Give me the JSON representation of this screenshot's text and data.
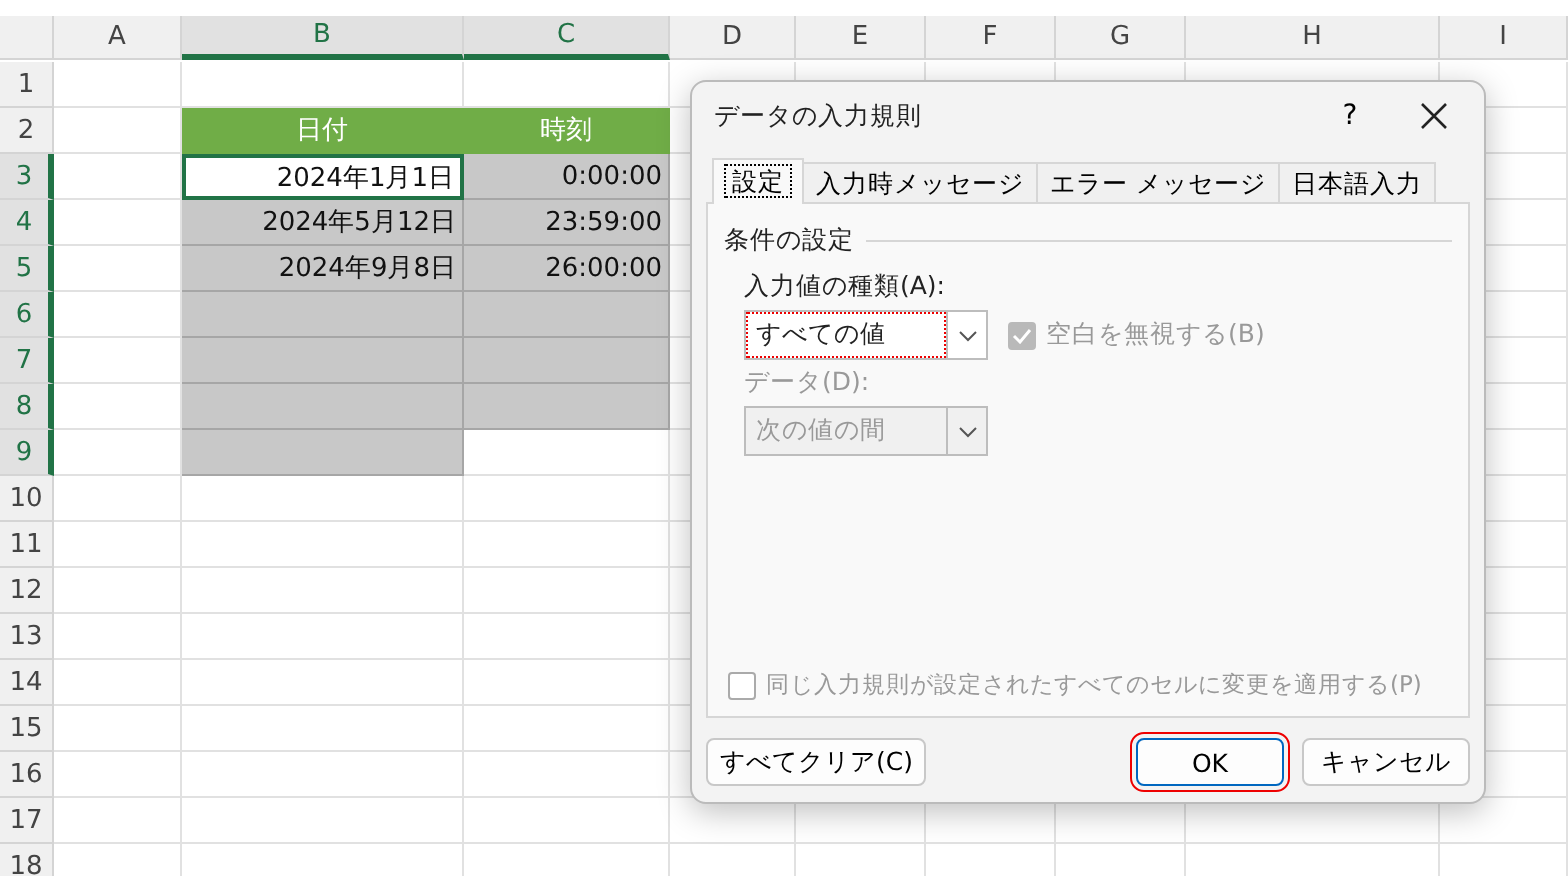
{
  "columns": [
    {
      "label": "A",
      "selected": false
    },
    {
      "label": "B",
      "selected": true
    },
    {
      "label": "C",
      "selected": true
    },
    {
      "label": "D",
      "selected": false
    },
    {
      "label": "E",
      "selected": false
    },
    {
      "label": "F",
      "selected": false
    },
    {
      "label": "G",
      "selected": false
    },
    {
      "label": "H",
      "selected": false
    },
    {
      "label": "I",
      "selected": false
    }
  ],
  "rows": [
    {
      "label": "1",
      "selected": false
    },
    {
      "label": "2",
      "selected": false,
      "b": {
        "text": "日付",
        "kind": "header"
      },
      "c": {
        "text": "時刻",
        "kind": "header"
      }
    },
    {
      "label": "3",
      "selected": true,
      "b": {
        "text": "2024年1月1日",
        "kind": "active"
      },
      "c": {
        "text": "0:00:00",
        "kind": "shaded"
      }
    },
    {
      "label": "4",
      "selected": true,
      "b": {
        "text": "2024年5月12日",
        "kind": "shaded"
      },
      "c": {
        "text": "23:59:00",
        "kind": "shaded"
      }
    },
    {
      "label": "5",
      "selected": true,
      "b": {
        "text": "2024年9月8日",
        "kind": "shaded"
      },
      "c": {
        "text": "26:00:00",
        "kind": "shaded"
      }
    },
    {
      "label": "6",
      "selected": true,
      "b": {
        "kind": "shaded"
      },
      "c": {
        "kind": "shaded"
      }
    },
    {
      "label": "7",
      "selected": true,
      "b": {
        "kind": "shaded"
      },
      "c": {
        "kind": "shaded"
      }
    },
    {
      "label": "8",
      "selected": true,
      "b": {
        "kind": "shaded"
      },
      "c": {
        "kind": "shaded"
      }
    },
    {
      "label": "9",
      "selected": true,
      "b": {
        "kind": "shaded"
      }
    },
    {
      "label": "10",
      "selected": false
    },
    {
      "label": "11",
      "selected": false
    },
    {
      "label": "12",
      "selected": false
    },
    {
      "label": "13",
      "selected": false
    },
    {
      "label": "14",
      "selected": false
    },
    {
      "label": "15",
      "selected": false
    },
    {
      "label": "16",
      "selected": false
    },
    {
      "label": "17",
      "selected": false
    },
    {
      "label": "18",
      "selected": false
    }
  ],
  "dialog": {
    "title": "データの入力規則",
    "help": "?",
    "tabs": [
      {
        "label": "設定",
        "selected": true
      },
      {
        "label": "入力時メッセージ",
        "selected": false
      },
      {
        "label": "エラー メッセージ",
        "selected": false
      },
      {
        "label": "日本語入力",
        "selected": false
      }
    ],
    "section": "条件の設定",
    "allow": {
      "label": "入力値の種類(A):",
      "value": "すべての値",
      "focused": true
    },
    "ignore_blank": {
      "label": "空白を無視する(B)",
      "checked": true,
      "disabled": true
    },
    "data": {
      "label": "データ(D):",
      "value": "次の値の間",
      "disabled": true
    },
    "apply_all": {
      "label": "同じ入力規則が設定されたすべてのセルに変更を適用する(P)",
      "checked": false,
      "disabled": true
    },
    "buttons": [
      {
        "label": "すべてクリア(C)",
        "kind": "left",
        "highlighted": false
      },
      {
        "label": "OK",
        "kind": "default",
        "highlighted": true
      },
      {
        "label": "キャンセル",
        "kind": "normal",
        "highlighted": false
      }
    ]
  }
}
